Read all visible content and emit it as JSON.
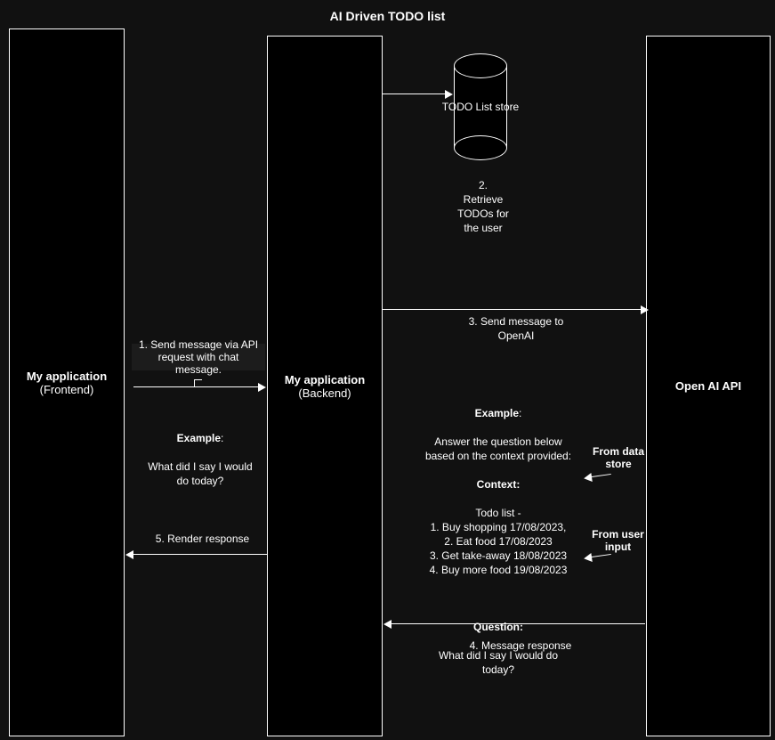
{
  "title": "AI Driven TODO list",
  "frontend": {
    "name": "My application",
    "role": "(Frontend)"
  },
  "backend": {
    "name": "My application",
    "role": "(Backend)"
  },
  "openai": {
    "name": "Open AI API"
  },
  "db": {
    "label": "TODO\nList store"
  },
  "step1": "1. Send message via API request with chat message.",
  "step1_example_head": "Example",
  "step1_example_body": "What did I say I would\ndo today?",
  "step2": "2.\nRetrieve\nTODOs for\nthe user",
  "step3": "3. Send message to\nOpenAI",
  "context_example_head": "Example",
  "context_example_intro": "Answer the question below\nbased on the context provided:",
  "context_head": "Context:",
  "context_body": "Todo list -\n1. Buy shopping 17/08/2023,\n2. Eat food 17/08/2023\n3. Get take-away 18/08/2023\n4. Buy more food 19/08/2023",
  "question_head": "Question:",
  "question_body": "What did I say I would do\ntoday?",
  "annot_store": "From data\nstore",
  "annot_user": "From\nuser input",
  "step4": "4. Message response",
  "step5": "5. Render response"
}
